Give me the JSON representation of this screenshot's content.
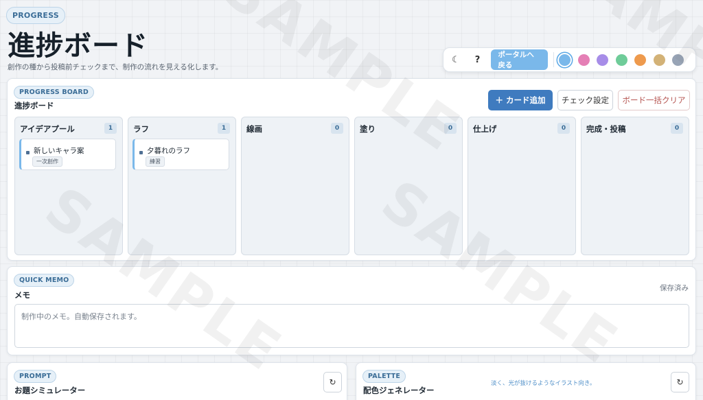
{
  "header": {
    "pill": "PROGRESS",
    "title": "進捗ボード",
    "subtitle": "創作の種から投稿前チェックまで、制作の流れを見える化します。"
  },
  "toolbar": {
    "theme_icon": "☾",
    "help_label": "?",
    "portal_label": "ポータルへ戻る",
    "swatches": [
      {
        "name": "blue",
        "color": "#7ab8ea",
        "active": true
      },
      {
        "name": "pink",
        "color": "#e57fb5"
      },
      {
        "name": "purple",
        "color": "#a78de8"
      },
      {
        "name": "green",
        "color": "#6fcc99"
      },
      {
        "name": "orange",
        "color": "#ee9a4d"
      },
      {
        "name": "tan",
        "color": "#d3b277"
      },
      {
        "name": "slate",
        "color": "#98a4b6"
      }
    ]
  },
  "board": {
    "pill": "PROGRESS BOARD",
    "title": "進捗ボード",
    "add_label": "＋ カード追加",
    "check_label": "チェック設定",
    "clear_label": "ボード一括クリア",
    "columns": [
      {
        "title": "アイデアプール",
        "count": "1",
        "cards": [
          {
            "title": "新しいキャラ案",
            "tag": "一次創作"
          }
        ]
      },
      {
        "title": "ラフ",
        "count": "1",
        "cards": [
          {
            "title": "夕暮れのラフ",
            "tag": "練習"
          }
        ]
      },
      {
        "title": "線画",
        "count": "0",
        "cards": []
      },
      {
        "title": "塗り",
        "count": "0",
        "cards": []
      },
      {
        "title": "仕上げ",
        "count": "0",
        "cards": []
      },
      {
        "title": "完成・投稿",
        "count": "0",
        "cards": []
      }
    ]
  },
  "memo": {
    "pill": "QUICK MEMO",
    "title": "メモ",
    "status": "保存済み",
    "placeholder": "制作中のメモ。自動保存されます。"
  },
  "prompt": {
    "pill": "PROMPT",
    "title": "お題シミュレーター",
    "refresh_icon": "↻"
  },
  "palette": {
    "pill": "PALETTE",
    "title": "配色ジェネレーター",
    "hint": "淡く、光が抜けるようなイラスト向き。",
    "refresh_icon": "↻"
  },
  "watermark": "SAMPLE"
}
